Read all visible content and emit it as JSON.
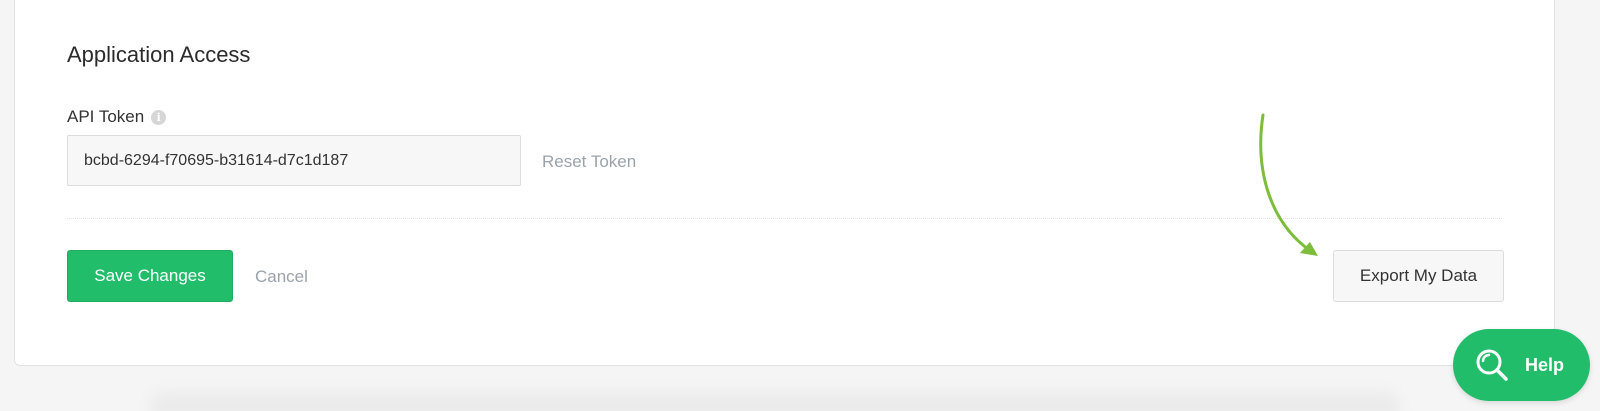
{
  "section": {
    "title": "Application Access"
  },
  "api_token": {
    "label": "API Token",
    "info_icon": "info-icon",
    "value": "bcbd-6294-f70695-b31614-d7c1d187",
    "reset_label": "Reset Token"
  },
  "actions": {
    "save_label": "Save Changes",
    "cancel_label": "Cancel",
    "export_label": "Export My Data"
  },
  "help": {
    "label": "Help",
    "icon": "search-icon"
  },
  "colors": {
    "accent_green": "#22bd6a",
    "annotation_arrow": "#7cbd3c",
    "muted_link": "#9aa3ab"
  }
}
